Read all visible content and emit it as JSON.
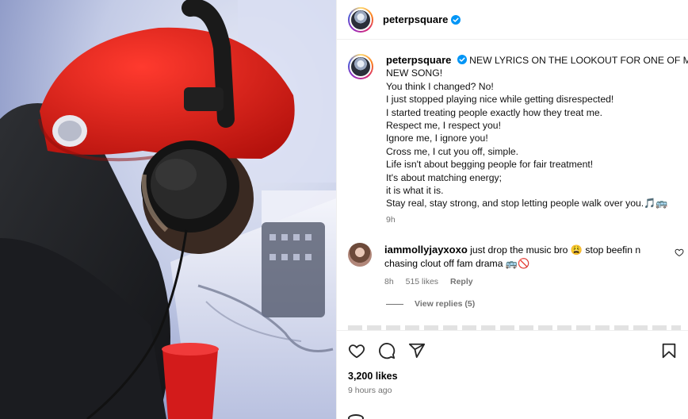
{
  "post": {
    "username": "peterpsquare",
    "verified_icon": "verified-badge-icon",
    "caption_lines": [
      "NEW LYRICS ON THE LOOKOUT FOR ONE OF MY",
      "NEW SONG!",
      "You think I changed? No!",
      "I just stopped playing nice while getting disrespected!",
      "I started treating people exactly how they treat me.",
      "Respect me, I respect you!",
      "Ignore me, I ignore you!",
      "Cross me, I cut you off, simple.",
      "Life isn't about begging people for fair treatment!",
      "It's about matching energy;",
      "it is what it is.",
      "Stay real, stay strong, and stop letting people walk over you.🎵🚌"
    ],
    "caption_time": "9h",
    "likes": "3,200 likes",
    "time_ago": "9 hours ago"
  },
  "comment": {
    "username": "iammollyjayxoxo",
    "text_line1": "just drop the music bro 😩 stop beefin n",
    "text_line2": "chasing clout off fam drama 🚌🚫",
    "time": "8h",
    "likes": "515 likes",
    "reply": "Reply",
    "view_replies": "View replies (5)"
  },
  "icons": {
    "like": "heart-icon",
    "comment": "comment-icon",
    "share": "share-icon",
    "save": "bookmark-icon"
  },
  "colors": {
    "accent_blue": "#0095f6",
    "muted": "#737373",
    "cap_red": "#e8231d"
  }
}
